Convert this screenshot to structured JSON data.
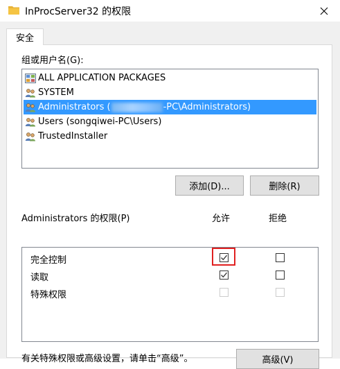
{
  "window": {
    "title": "InProcServer32 的权限"
  },
  "tabs": [
    {
      "label": "安全"
    }
  ],
  "group_label": "组或用户名(G):",
  "principals": [
    {
      "label": "ALL APPLICATION PACKAGES",
      "icon": "package-group-icon",
      "selected": false
    },
    {
      "label": "SYSTEM",
      "icon": "users-icon",
      "selected": false
    },
    {
      "label_prefix": "Administrators (",
      "label_suffix": "-PC\\Administrators)",
      "icon": "users-icon",
      "selected": true
    },
    {
      "label": "Users (songqiwei-PC\\Users)",
      "icon": "users-icon",
      "selected": false
    },
    {
      "label": "TrustedInstaller",
      "icon": "users-icon",
      "selected": false
    }
  ],
  "buttons": {
    "add": "添加(D)...",
    "remove": "删除(R)",
    "advanced": "高级(V)"
  },
  "permissions": {
    "header": "Administrators 的权限(P)",
    "allow_header": "允许",
    "deny_header": "拒绝",
    "rows": [
      {
        "name": "完全控制",
        "allow": true,
        "deny": false,
        "enabled": true
      },
      {
        "name": "读取",
        "allow": true,
        "deny": false,
        "enabled": true
      },
      {
        "name": "特殊权限",
        "allow": false,
        "deny": false,
        "enabled": false
      }
    ]
  },
  "footer_text": "有关特殊权限或高级设置，请单击“高级”。",
  "colors": {
    "selection": "#3399ff",
    "highlight": "#e02020",
    "folder": "#f5c443"
  }
}
